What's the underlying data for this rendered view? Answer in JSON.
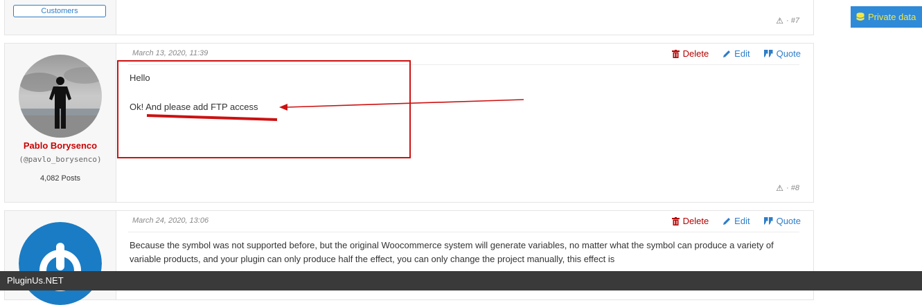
{
  "post7": {
    "role_badge": "Customers",
    "number": "· #7"
  },
  "post8": {
    "date": "March 13, 2020, 11:39",
    "actions": {
      "delete": "Delete",
      "edit": "Edit",
      "quote": "Quote"
    },
    "author": {
      "name": "Pablo Borysenco",
      "handle": "(@pavlo_borysenco)",
      "posts": "4,082 Posts"
    },
    "lines": [
      "Hello",
      "Ok!  And  please add FTP access"
    ],
    "number": "· #8"
  },
  "post9": {
    "date": "March 24, 2020, 13:06",
    "actions": {
      "delete": "Delete",
      "edit": "Edit",
      "quote": "Quote"
    },
    "body": "Because the symbol was not supported before, but the original Woocommerce system will generate variables, no matter what the symbol can produce a variety of variable products, and your plugin can only produce half the effect, you can only change the project manually, this effect is"
  },
  "sidebar": {
    "private_data_label": "Private data"
  },
  "footer": {
    "site": "PluginUs.NET"
  },
  "colors": {
    "accent_blue": "#2f7dc7",
    "delete_red": "#b30000",
    "annotation_red": "#cc1111"
  }
}
